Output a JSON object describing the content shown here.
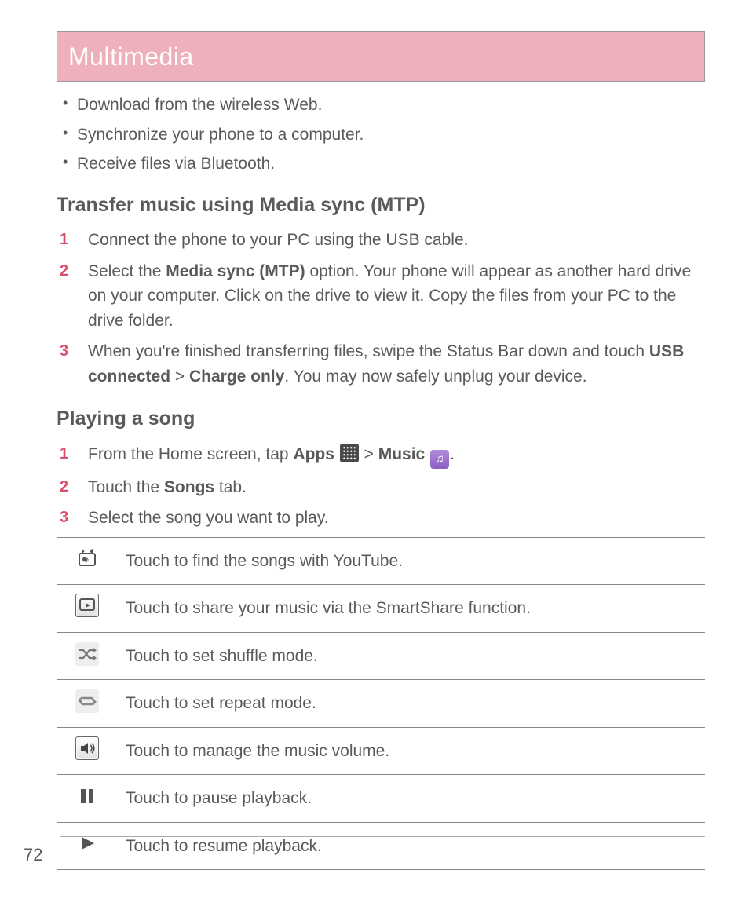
{
  "header": {
    "title": "Multimedia"
  },
  "bullets": [
    "Download from the wireless Web.",
    "Synchronize your phone to a computer.",
    "Receive files via Bluetooth."
  ],
  "section1": {
    "title": "Transfer music using Media sync (MTP)",
    "steps": {
      "s1": "Connect the phone to your PC using the USB cable.",
      "s2a": "Select the ",
      "s2b": "Media sync (MTP)",
      "s2c": " option. Your phone will appear as another hard drive on your computer. Click on the drive to view it. Copy the files from your PC to the drive folder.",
      "s3a": "When you're finished transferring files, swipe the Status Bar down and touch ",
      "s3b": "USB connected",
      "s3c": " > ",
      "s3d": "Charge only",
      "s3e": ". You may now safely unplug your device."
    }
  },
  "section2": {
    "title": "Playing a song",
    "steps": {
      "s1a": "From the Home screen, tap ",
      "s1b": "Apps",
      "s1c": " > ",
      "s1d": "Music",
      "s1e": ".",
      "s2a": "Touch the ",
      "s2b": "Songs",
      "s2c": " tab.",
      "s3": "Select the song you want to play."
    }
  },
  "table": {
    "row1": "Touch to find the songs with YouTube.",
    "row2": "Touch to share your music via the SmartShare function.",
    "row3": "Touch to set shuffle mode.",
    "row4": "Touch to set repeat mode.",
    "row5": "Touch to manage the music volume.",
    "row6": "Touch to pause playback.",
    "row7": "Touch to resume playback."
  },
  "page_number": "72",
  "icons": {
    "music_glyph": "♫"
  }
}
